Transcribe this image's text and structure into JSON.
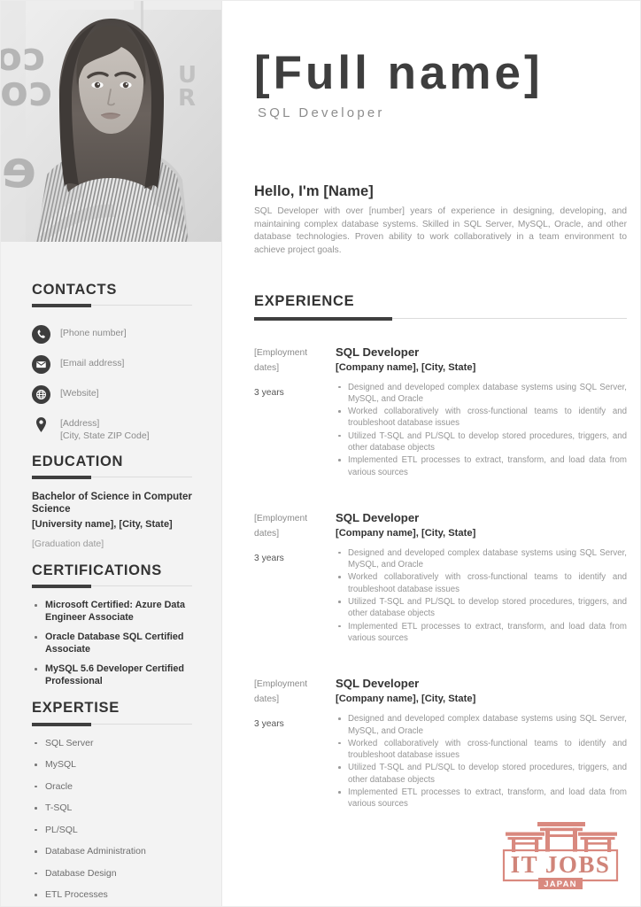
{
  "header": {
    "full_name": "[Full name]",
    "role": "SQL Developer"
  },
  "about": {
    "heading": "Hello, I'm [Name]",
    "summary": "SQL Developer with over [number] years of experience in designing, developing, and maintaining complex database systems. Skilled in SQL Server, MySQL, Oracle, and other database technologies. Proven ability to work collaboratively in a team environment to achieve project goals."
  },
  "sidebar": {
    "contacts": {
      "heading": "CONTACTS",
      "items": [
        {
          "icon": "phone-icon",
          "lines": [
            "[Phone number]"
          ]
        },
        {
          "icon": "envelope-icon",
          "lines": [
            "[Email address]"
          ]
        },
        {
          "icon": "globe-icon",
          "lines": [
            "[Website]"
          ]
        },
        {
          "icon": "location-pin-icon",
          "lines": [
            "[Address]",
            "[City, State ZIP Code]"
          ]
        }
      ]
    },
    "education": {
      "heading": "EDUCATION",
      "degree": "Bachelor of Science in Computer Science",
      "university": "[University name], [City, State]",
      "graduation": "[Graduation date]"
    },
    "certifications": {
      "heading": "CERTIFICATIONS",
      "items": [
        "Microsoft Certified: Azure Data Engineer Associate",
        "Oracle Database SQL Certified Associate",
        "MySQL 5.6 Developer Certified Professional"
      ]
    },
    "expertise": {
      "heading": "EXPERTISE",
      "items": [
        "SQL Server",
        "MySQL",
        "Oracle",
        "T-SQL",
        "PL/SQL",
        "Database Administration",
        "Database Design",
        "ETL Processes"
      ]
    }
  },
  "experience": {
    "heading": "EXPERIENCE",
    "jobs": [
      {
        "dates": "[Employment dates]",
        "duration": "3 years",
        "title": "SQL Developer",
        "company": "[Company name], [City, State]",
        "bullets": [
          "Designed and developed complex database systems using SQL Server, MySQL, and Oracle",
          "Worked collaboratively with cross-functional teams to identify and troubleshoot database issues",
          "Utilized T-SQL and PL/SQL to develop stored procedures, triggers, and other database objects",
          "Implemented ETL processes to extract, transform, and load data from various sources"
        ]
      },
      {
        "dates": "[Employment dates]",
        "duration": "3 years",
        "title": "SQL Developer",
        "company": "[Company name], [City, State]",
        "bullets": [
          "Designed and developed complex database systems using SQL Server, MySQL, and Oracle",
          "Worked collaboratively with cross-functional teams to identify and troubleshoot database issues",
          "Utilized T-SQL and PL/SQL to develop stored procedures, triggers, and other database objects",
          "Implemented ETL processes to extract, transform, and load data from various sources"
        ]
      },
      {
        "dates": "[Employment dates]",
        "duration": "3 years",
        "title": "SQL Developer",
        "company": "[Company name], [City, State]",
        "bullets": [
          "Designed and developed complex database systems using SQL Server, MySQL, and Oracle",
          "Worked collaboratively with cross-functional teams to identify and troubleshoot database issues",
          "Utilized T-SQL and PL/SQL to develop stored procedures, triggers, and other database objects",
          "Implemented ETL processes to extract, transform, and load data from various sources"
        ]
      }
    ]
  },
  "logo": {
    "primary_text": "IT JOBS",
    "banner_text": "JAPAN",
    "color": "#d9897f"
  },
  "photo": {
    "alt": "grayscale portrait of woman with long dark hair in striped shirt, arms crossed"
  },
  "colors": {
    "sidebar_bg": "#f3f3f3",
    "heading": "#333333",
    "body_text": "#949494",
    "rule_dark": "#3f3f3f",
    "rule_light": "#dcdcdc"
  }
}
